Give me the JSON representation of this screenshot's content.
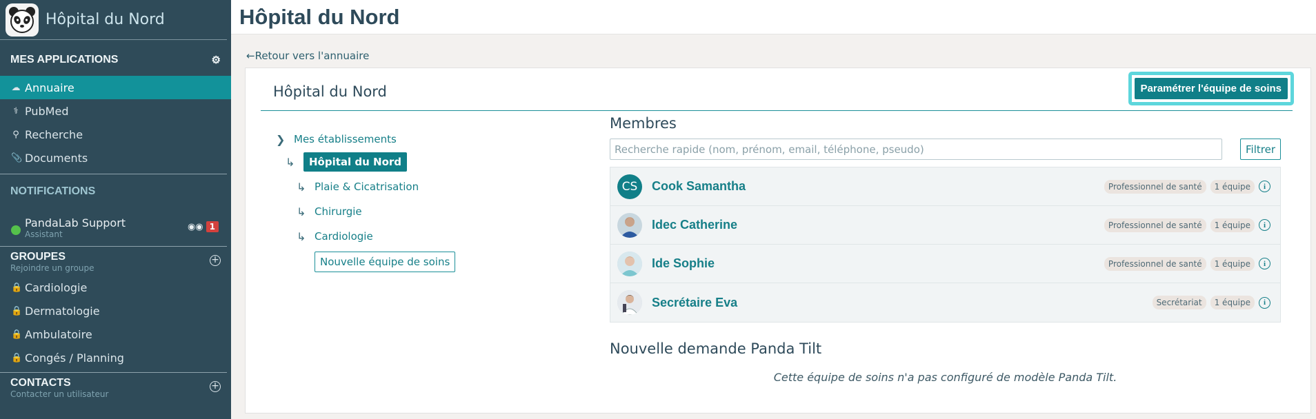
{
  "app": {
    "title": "Hôpital du Nord",
    "page_title": "Hôpital du Nord"
  },
  "sidebar": {
    "apps_title": "MES APPLICATIONS",
    "apps": [
      {
        "label": "Annuaire",
        "icon": "cloud-icon",
        "active": true
      },
      {
        "label": "PubMed",
        "icon": "doctor-icon",
        "active": false
      },
      {
        "label": "Recherche",
        "icon": "search-icon",
        "active": false
      },
      {
        "label": "Documents",
        "icon": "paperclip-icon",
        "active": false
      }
    ],
    "notifications_title": "NOTIFICATIONS",
    "notification": {
      "name": "PandaLab Support",
      "subtitle": "Assistant",
      "count": "1"
    },
    "groups_title": "GROUPES",
    "groups_subtitle": "Rejoindre un groupe",
    "groups": [
      "Cardiologie",
      "Dermatologie",
      "Ambulatoire",
      "Congés / Planning"
    ],
    "contacts_title": "CONTACTS",
    "contacts_subtitle": "Contacter un utilisateur"
  },
  "back_link": "Retour vers l'annuaire",
  "card": {
    "title": "Hôpital du Nord",
    "config_button": "Paramétrer l'équipe de soins"
  },
  "tree": {
    "root": "Mes établissements",
    "active": "Hôpital du Nord",
    "children": [
      "Plaie & Cicatrisation",
      "Chirurgie",
      "Cardiologie"
    ],
    "new_team": "Nouvelle équipe de soins"
  },
  "members": {
    "title": "Membres",
    "search_placeholder": "Recherche rapide (nom, prénom, email, téléphone, pseudo)",
    "filter_button": "Filtrer",
    "list": [
      {
        "initials": "CS",
        "name": "Cook Samantha",
        "role": "Professionnel de santé",
        "teams": "1 équipe"
      },
      {
        "initials": "",
        "name": "Idec Catherine",
        "role": "Professionnel de santé",
        "teams": "1 équipe"
      },
      {
        "initials": "",
        "name": "Ide Sophie",
        "role": "Professionnel de santé",
        "teams": "1 équipe"
      },
      {
        "initials": "",
        "name": "Secrétaire Eva",
        "role": "Secrétariat",
        "teams": "1 équipe"
      }
    ]
  },
  "tilt": {
    "title": "Nouvelle demande Panda Tilt",
    "message": "Cette équipe de soins n'a pas configuré de modèle Panda Tilt."
  },
  "colors": {
    "sidebar": "#2f4b59",
    "accent": "#107f88",
    "highlight": "#5dd6dc"
  }
}
